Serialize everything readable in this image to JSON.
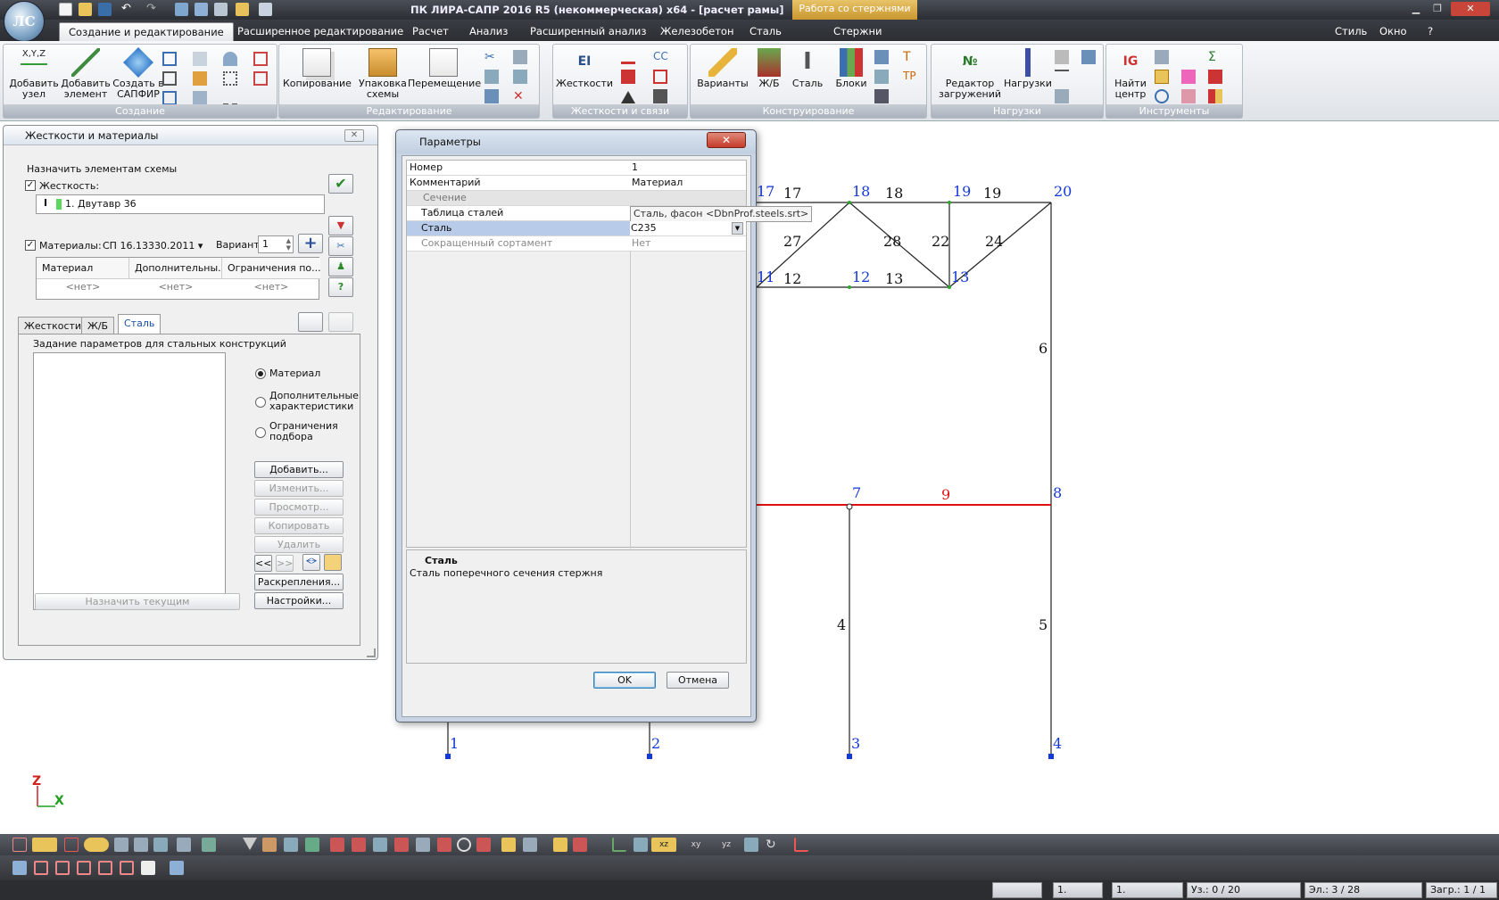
{
  "window": {
    "title": "ПК ЛИРА-САПР  2016 R5 (некоммерческая) x64 - [расчет рамы]",
    "context_tab": "Работа со стержнями"
  },
  "tabs": [
    "Создание и редактирование",
    "Расширенное редактирование",
    "Расчет",
    "Анализ",
    "Расширенный анализ",
    "Железобетон",
    "Сталь",
    "Стержни"
  ],
  "right_menu": {
    "style": "Стиль",
    "window": "Окно",
    "help": "?"
  },
  "ribbon": {
    "groups": [
      "Создание",
      "Редактирование",
      "Жесткости и связи",
      "Конструирование",
      "Нагрузки",
      "Инструменты"
    ],
    "buttons": {
      "add_node": "Добавить узел",
      "add_elem": "Добавить элемент",
      "create_sapfir": "Создать в САПФИР",
      "copy": "Копирование",
      "pack": "Упаковка схемы",
      "move": "Перемещение",
      "stiffness": "Жесткости",
      "variants": "Варианты",
      "rc": "Ж/Б",
      "steel": "Сталь",
      "blocks": "Блоки",
      "load_editor": "Редактор загружений",
      "loads": "Нагрузки",
      "find_center": "Найти центр"
    },
    "xyz_label": "X,Y,Z"
  },
  "left_panel": {
    "title": "Жесткости и материалы",
    "assign_group": "Назначить элементам схемы",
    "stiffness_label": "Жесткость:",
    "stiffness_value": "1. Двутавр 36",
    "materials_label": "Материалы:",
    "materials_value": "СП 16.13330.2011",
    "variant_label": "Вариант",
    "variant_value": "1",
    "table_headers": [
      "Материал",
      "Дополнительны...",
      "Ограничения по..."
    ],
    "table_cells": [
      "<нет>",
      "<нет>",
      "<нет>"
    ],
    "tabs": [
      "Жесткости",
      "Ж/Б",
      "Сталь"
    ],
    "steel_caption": "Задание параметров для стальных конструкций",
    "radios": [
      "Материал",
      "Дополнительные характеристики",
      "Ограничения подбора"
    ],
    "buttons": [
      "Добавить...",
      "Изменить...",
      "Просмотр...",
      "Копировать",
      "Удалить"
    ],
    "nav": [
      "<<",
      ">>"
    ],
    "fastening": "Раскрепления...",
    "settings": "Настройки...",
    "assign_current": "Назначить текущим"
  },
  "params": {
    "title": "Параметры",
    "rows": [
      {
        "k": "Номер",
        "v": "1"
      },
      {
        "k": "Комментарий",
        "v": "Материал"
      },
      {
        "k": "Сечение",
        "v": ""
      },
      {
        "k": "Таблица сталей",
        "v": "Сталь, фасон <DbnProf.steels.srt>"
      },
      {
        "k": "Сталь",
        "v": "С235"
      },
      {
        "k": "Сокращенный сортамент",
        "v": "Нет"
      }
    ],
    "desc_title": "Сталь",
    "desc_text": "Сталь поперечного сечения стержня",
    "ok": "OK",
    "cancel": "Отмена"
  },
  "drawing": {
    "nodes": [
      "1",
      "2",
      "3",
      "4",
      "7",
      "8",
      "11",
      "12",
      "13",
      "17",
      "18",
      "19",
      "20"
    ],
    "elements": [
      "4",
      "5",
      "6",
      "9",
      "12",
      "13",
      "17",
      "18",
      "19",
      "22",
      "24",
      "27",
      "28"
    ],
    "axis": {
      "z": "Z",
      "x": "X"
    },
    "highlight_color": "#e01010"
  },
  "status": {
    "field1": "1.",
    "field2": "1.",
    "nodes": "Уз.: 0 / 20",
    "elements": "Эл.: 3 / 28",
    "loads": "Загр.: 1 / 1"
  }
}
